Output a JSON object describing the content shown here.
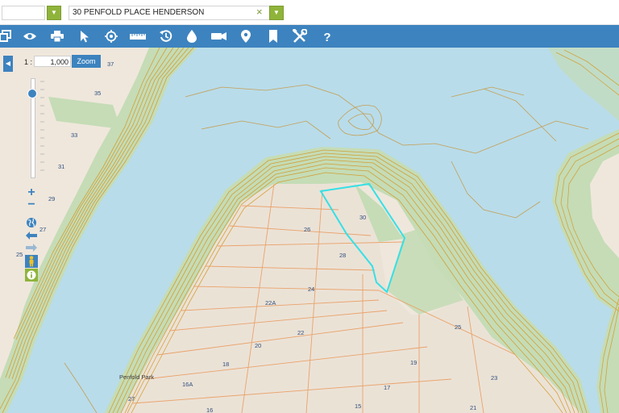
{
  "search": {
    "first_value": "",
    "address_value": "30 PENFOLD PLACE HENDERSON",
    "clear_glyph": "×",
    "dropdown_glyph": "▼"
  },
  "toolbar": {
    "tools": [
      "layers-icon",
      "eye-icon",
      "print-icon",
      "pointer-icon",
      "locate-icon",
      "ruler-icon",
      "history-icon",
      "water-drop-icon",
      "camera-icon",
      "place-marker-icon",
      "bookmark-icon",
      "tools-icon",
      "help-icon"
    ]
  },
  "map_controls": {
    "collapse_glyph": "◀",
    "scale_prefix": "1 :",
    "scale_value": "1,000",
    "zoom_label": "Zoom",
    "zoom_in": "+",
    "zoom_out": "−"
  },
  "map": {
    "lots": [
      "37",
      "35",
      "33",
      "31",
      "29",
      "27",
      "25",
      "30",
      "26",
      "28",
      "24",
      "22A",
      "22",
      "20",
      "18",
      "16A",
      "16",
      "15",
      "17",
      "19",
      "21",
      "23",
      "25",
      "27"
    ],
    "park_label": "Penfold Park",
    "colors": {
      "water": "#b8dcea",
      "land": "#efe7dc",
      "bush": "#c5dcb6",
      "contour": "#d39622",
      "parcel_line": "#eaa36b",
      "selected_parcel": "#35e0e6",
      "toolbar": "#3d83bf",
      "accent_green": "#8fb43a"
    }
  }
}
